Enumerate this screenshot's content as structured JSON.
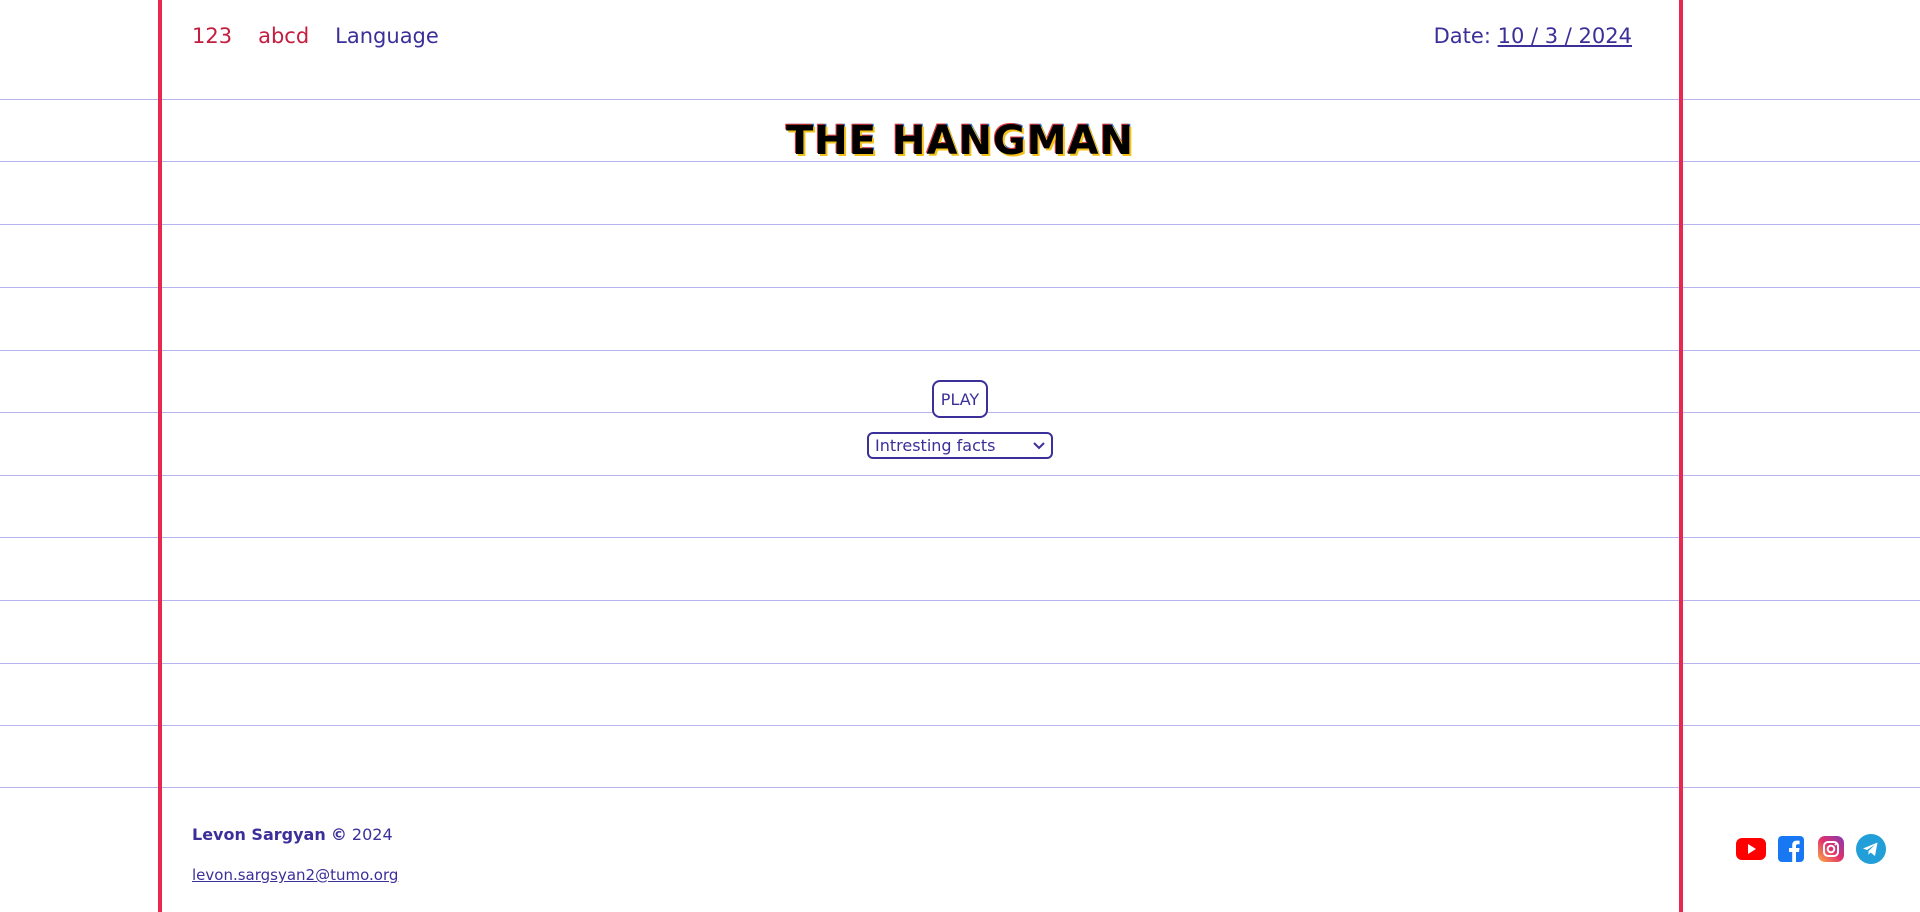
{
  "nav": {
    "numbers_label": "123",
    "letters_label": "abcd",
    "language_label": "Language"
  },
  "date": {
    "label": "Date:",
    "value": "10 / 3 / 2024"
  },
  "title": "THE HANGMAN",
  "game": {
    "play_label": "PLAY",
    "category_selected": "Intresting facts"
  },
  "footer": {
    "author": "Levon Sargyan",
    "copyright_symbol": "©",
    "year": "2024",
    "email": "levon.sargsyan2@tumo.org"
  },
  "socials": [
    {
      "icon": "youtube-icon",
      "color": "#ff0000"
    },
    {
      "icon": "facebook-icon",
      "color": "#1877f2"
    },
    {
      "icon": "instagram-icon",
      "color": "#d6249f"
    },
    {
      "icon": "telegram-icon",
      "color": "#229ed9"
    }
  ],
  "colors": {
    "accent_blue": "#3b2f9a",
    "margin_red": "#e8284e",
    "rule_line": "#b7b3ee"
  }
}
